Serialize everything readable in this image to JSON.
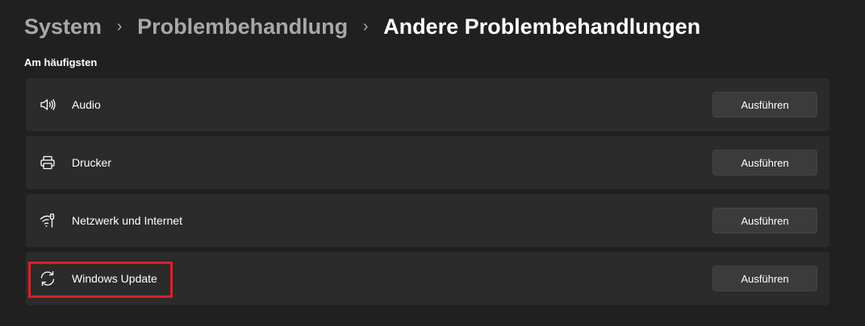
{
  "breadcrumb": {
    "items": [
      "System",
      "Problembehandlung"
    ],
    "current": "Andere Problembehandlungen",
    "separator": "›"
  },
  "section": {
    "title": "Am häufigsten"
  },
  "troubleshooters": [
    {
      "label": "Audio",
      "icon": "speaker-icon",
      "button": "Ausführen"
    },
    {
      "label": "Drucker",
      "icon": "printer-icon",
      "button": "Ausführen"
    },
    {
      "label": "Netzwerk und Internet",
      "icon": "wifi-icon",
      "button": "Ausführen"
    },
    {
      "label": "Windows Update",
      "icon": "sync-icon",
      "button": "Ausführen"
    }
  ],
  "annotation": {
    "highlight_color": "#d9202b",
    "highlighted_item": "Windows Update"
  },
  "colors": {
    "background": "#202020",
    "card": "#2b2b2b",
    "button": "#3b3b3b",
    "muted_text": "#a8a8a8"
  }
}
